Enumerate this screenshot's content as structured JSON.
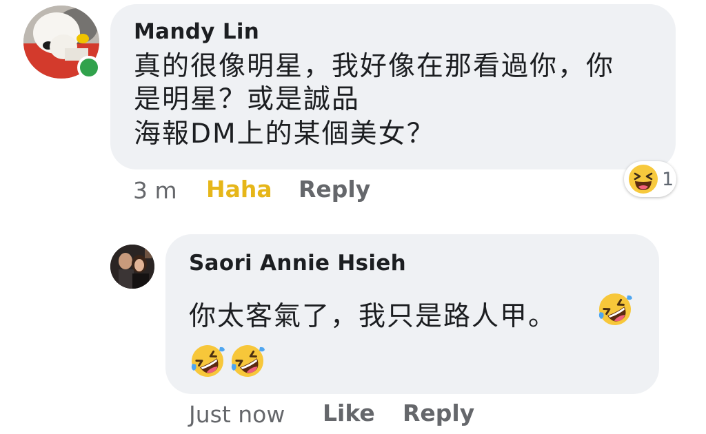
{
  "comments": [
    {
      "author": "Mandy Lin",
      "lines": [
        "真的很像明星，我好像在那看過你，你",
        "是明星？或是誠品",
        "海報DM上的某個美女？"
      ],
      "time": "3 m",
      "my_reaction_label": "Haha",
      "reply_label": "Reply",
      "reaction_summary": {
        "icon": "haha-reaction-icon",
        "count": "1"
      },
      "online_status_color": "#31a24c"
    },
    {
      "author": "Saori Annie Hsieh",
      "text": "你太客氣了，我只是路人甲。",
      "emojis": [
        "rolling-on-floor-laughing-icon",
        "rolling-on-floor-laughing-icon",
        "rolling-on-floor-laughing-icon"
      ],
      "time": "Just now",
      "like_label": "Like",
      "reply_label": "Reply"
    }
  ],
  "colors": {
    "bubble": "#eff1f4",
    "text": "#1c1e21",
    "meta": "#65676b",
    "haha_active": "#e6b619"
  }
}
